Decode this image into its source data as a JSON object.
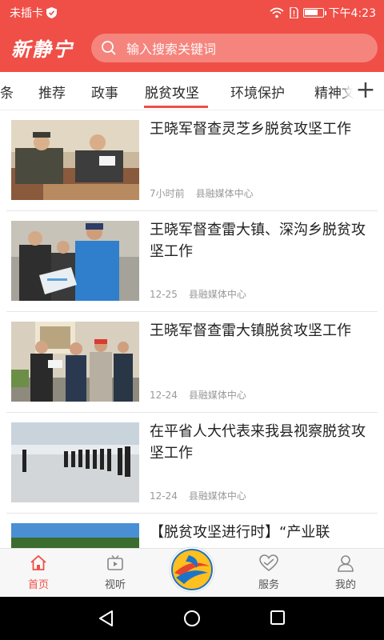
{
  "status": {
    "carrier": "未插卡",
    "time": "下午4:23",
    "battery_percent": 80
  },
  "header": {
    "logo_text": "新静宁",
    "search_placeholder": "输入搜索关键词"
  },
  "tabs": [
    {
      "label": "条"
    },
    {
      "label": "推荐"
    },
    {
      "label": "政事"
    },
    {
      "label": "脱贫攻坚",
      "active": true
    },
    {
      "label": "环境保护"
    },
    {
      "label": "精神文"
    }
  ],
  "articles": [
    {
      "title": "王晓军督查灵芝乡脱贫攻坚工作",
      "time": "7小时前",
      "source": "县融媒体中心"
    },
    {
      "title": "王晓军督查雷大镇、深沟乡脱贫攻坚工作",
      "time": "12-25",
      "source": "县融媒体中心"
    },
    {
      "title": "王晓军督查雷大镇脱贫攻坚工作",
      "time": "12-24",
      "source": "县融媒体中心"
    },
    {
      "title": "在平省人大代表来我县视察脱贫攻坚工作",
      "time": "12-24",
      "source": "县融媒体中心"
    },
    {
      "title": "【脱贫攻坚进行时】“产业联",
      "time": "",
      "source": ""
    }
  ],
  "bottom_nav": [
    {
      "label": "首页",
      "icon": "home-icon",
      "active": true
    },
    {
      "label": "视听",
      "icon": "tv-icon"
    },
    {
      "label": "服务",
      "icon": "heart-icon"
    },
    {
      "label": "我的",
      "icon": "user-icon"
    }
  ],
  "colors": {
    "brand": "#ef4f47",
    "search_bg": "#f5847d",
    "meta_text": "#999999"
  }
}
